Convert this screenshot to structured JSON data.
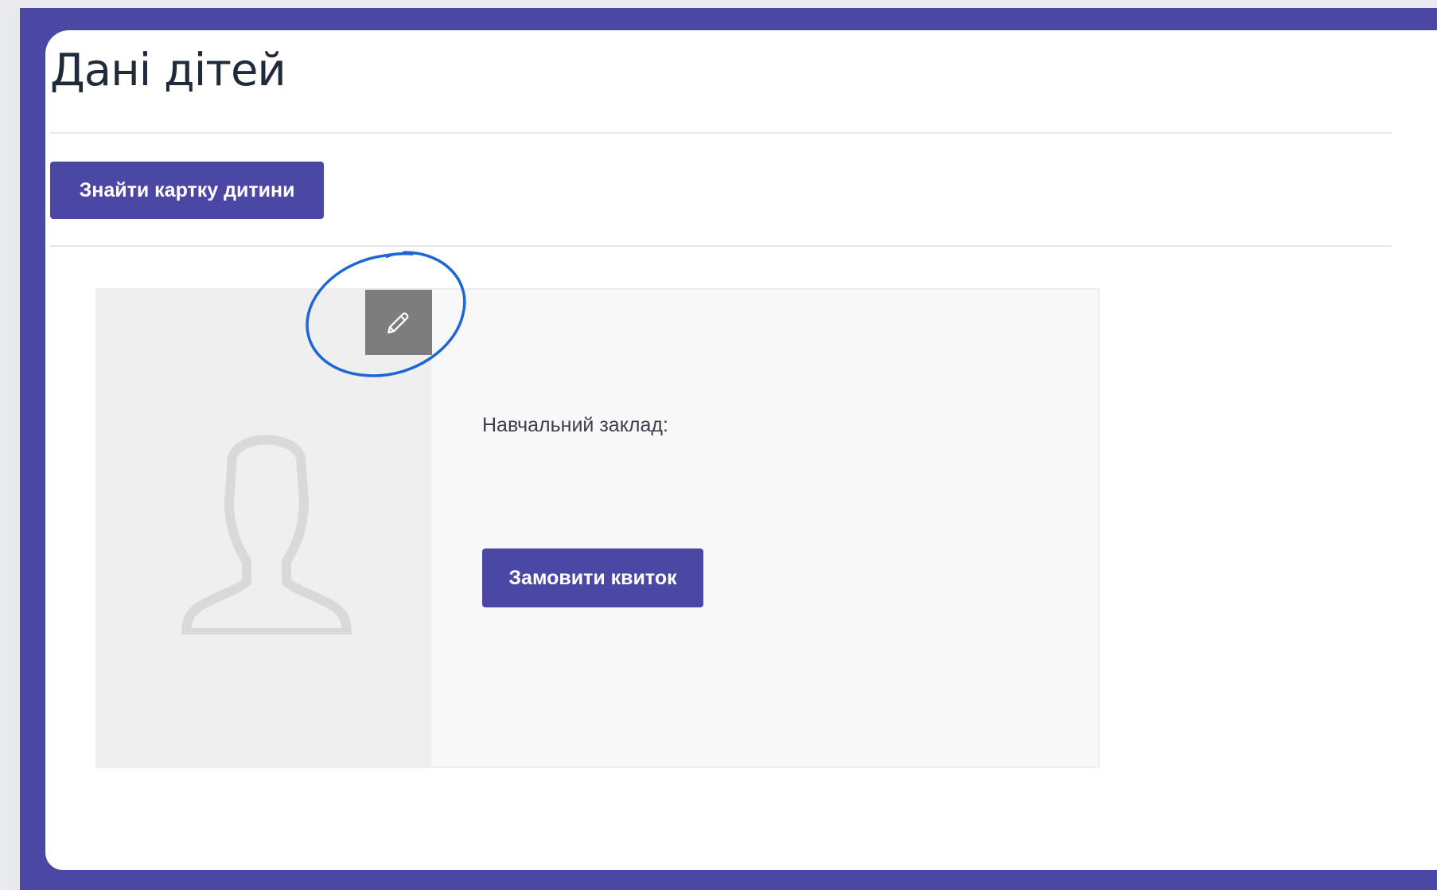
{
  "page": {
    "title": "Дані дітей"
  },
  "toolbar": {
    "find_child_card_label": "Знайти картку дитини"
  },
  "child_card": {
    "school_label": "Навчальний заклад:",
    "order_ticket_label": "Замовити квиток"
  },
  "icons": {
    "edit": "pencil-icon",
    "avatar": "user-silhouette-icon"
  },
  "colors": {
    "brand": "#4b48a5",
    "edit_button": "#7d7d7d",
    "annotation": "#1d66d8"
  }
}
